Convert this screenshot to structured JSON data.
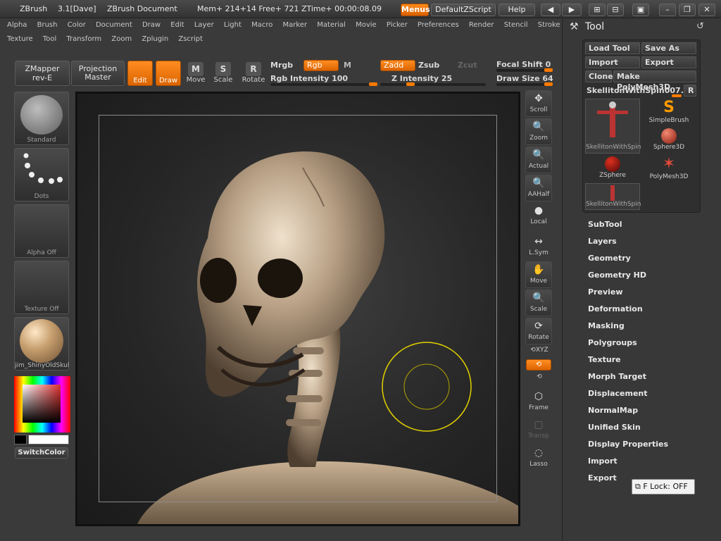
{
  "titlebar": {
    "app": "ZBrush",
    "version": "3.1[Dave]",
    "document": "ZBrush Document",
    "mem": "Mem+ 214+14  Free+ 721  ZTime+ 00:00:08.09",
    "menus_btn": "Menus",
    "script_btn": "DefaultZScript",
    "help_btn": "Help"
  },
  "menus_row1": [
    "Alpha",
    "Brush",
    "Color",
    "Document",
    "Draw",
    "Edit",
    "Layer",
    "Light",
    "Macro",
    "Marker",
    "Material",
    "Movie",
    "Picker",
    "Preferences",
    "Render",
    "Stencil",
    "Stroke"
  ],
  "menus_row2": [
    "Texture",
    "Tool",
    "Transform",
    "Zoom",
    "Zplugin",
    "Zscript"
  ],
  "shelf": {
    "zmapper": "ZMapper",
    "zmapper2": "rev-E",
    "projection": "Projection",
    "projection2": "Master",
    "edit": "Edit",
    "draw": "Draw",
    "move": "Move",
    "scale": "Scale",
    "rotate": "Rotate",
    "mrgb": "Mrgb",
    "rgb": "Rgb",
    "m": "M",
    "rgb_intensity": "Rgb  Intensity 100",
    "zadd": "Zadd",
    "zsub": "Zsub",
    "zcut": "Zcut",
    "z_intensity": "Z  Intensity 25",
    "focal_shift": "Focal Shift 0",
    "draw_size": "Draw  Size 64"
  },
  "left": {
    "brush": "Standard",
    "stroke": "Dots",
    "alpha": "Alpha  Off",
    "texture": "Texture  Off",
    "material": "jim_ShinyOldSkul",
    "switch_color": "SwitchColor"
  },
  "right_tools": [
    "Scroll",
    "Zoom",
    "Actual",
    "AAHalf",
    "Local",
    "L.Sym",
    "Move",
    "Scale",
    "Rotate",
    "XYZ",
    "",
    "",
    "Frame",
    "Transp",
    "Lasso"
  ],
  "tool_panel": {
    "title": "Tool",
    "load_tool": "Load Tool",
    "save_as": "Save As",
    "import": "Import",
    "export": "Export",
    "clone": "Clone",
    "make_polymesh": "Make PolyMesh3D",
    "current_tool": "SkellitonWithSpin007.",
    "r": "R",
    "tools": [
      {
        "name": "SkellitonWithSpin"
      },
      {
        "name": "SimpleBrush"
      },
      {
        "name": "Sphere3D"
      },
      {
        "name": "ZSphere"
      },
      {
        "name": "PolyMesh3D"
      },
      {
        "name": "SkellitonWithSpin"
      }
    ],
    "subpalettes": [
      "SubTool",
      "Layers",
      "Geometry",
      "Geometry HD",
      "Preview",
      "Deformation",
      "Masking",
      "Polygroups",
      "Texture",
      "Morph Target",
      "Displacement",
      "NormalMap",
      "Unified Skin",
      "Display Properties",
      "Import",
      "Export"
    ],
    "flock": "F Lock: OFF"
  },
  "colors": {
    "accent": "#ff7a00",
    "ring": "#e0d000",
    "bone": "#b79f84"
  }
}
